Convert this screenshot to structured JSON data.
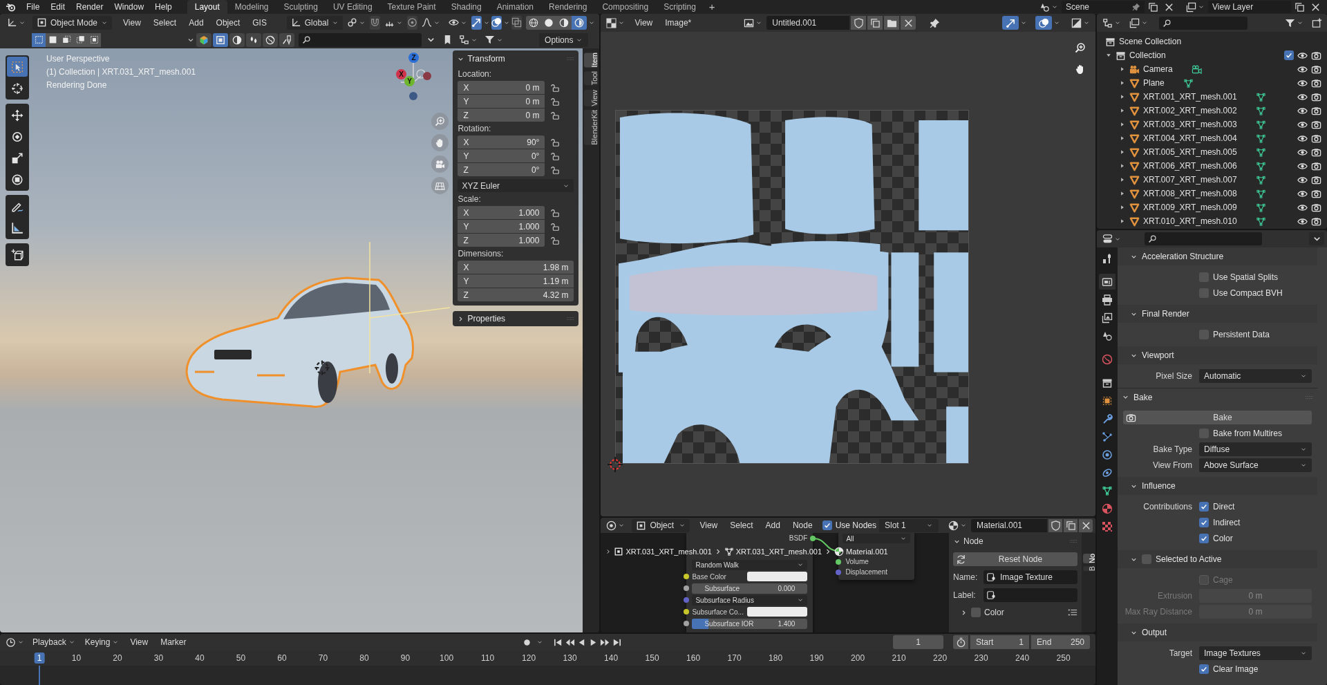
{
  "top_bar": {
    "menus": [
      "File",
      "Edit",
      "Render",
      "Window",
      "Help"
    ],
    "workspaces": [
      {
        "label": "Layout",
        "selected": true
      },
      {
        "label": "Modeling",
        "selected": false
      },
      {
        "label": "Sculpting",
        "selected": false
      },
      {
        "label": "UV Editing",
        "selected": false
      },
      {
        "label": "Texture Paint",
        "selected": false
      },
      {
        "label": "Shading",
        "selected": false
      },
      {
        "label": "Animation",
        "selected": false
      },
      {
        "label": "Rendering",
        "selected": false
      },
      {
        "label": "Compositing",
        "selected": false
      },
      {
        "label": "Scripting",
        "selected": false
      }
    ],
    "add_workspace": "+",
    "scene": "Scene",
    "view_layer": "View Layer"
  },
  "viewport": {
    "mode": "Object Mode",
    "menus": [
      "View",
      "Select",
      "Add",
      "Object",
      "GIS"
    ],
    "orientation": "Global",
    "toggles": [
      {
        "kind": "snap",
        "on": false
      },
      {
        "kind": "proportional",
        "on": false
      },
      {
        "kind": "gizmos",
        "on": true
      },
      {
        "kind": "overlays",
        "on": true
      },
      {
        "kind": "xray",
        "on": false
      }
    ],
    "shading": [
      {
        "kind": "wireframe",
        "selected": false
      },
      {
        "kind": "solid",
        "selected": false
      },
      {
        "kind": "material",
        "selected": false
      },
      {
        "kind": "rendered",
        "selected": true
      }
    ],
    "select_modes": [
      {
        "selected": true
      },
      {
        "selected": false
      },
      {
        "selected": false
      },
      {
        "selected": false
      },
      {
        "selected": false
      }
    ],
    "asset_types": [
      {
        "kind": "model",
        "selected": false
      },
      {
        "kind": "scene",
        "selected": true
      },
      {
        "kind": "material",
        "selected": false
      },
      {
        "kind": "hdr",
        "selected": false
      },
      {
        "kind": "world",
        "selected": false
      },
      {
        "kind": "brush",
        "selected": false
      }
    ],
    "options": "Options",
    "info": [
      "User Perspective",
      "(1) Collection | XRT.031_XRT_mesh.001",
      "Rendering Done"
    ],
    "tool_groups": [
      [
        {
          "kind": "select",
          "selected": true
        },
        {
          "kind": "cursor",
          "selected": false
        }
      ],
      [
        {
          "kind": "move",
          "selected": false
        },
        {
          "kind": "rotate",
          "selected": false
        },
        {
          "kind": "scale",
          "selected": false
        },
        {
          "kind": "transform",
          "selected": false
        }
      ],
      [
        {
          "kind": "annotate",
          "selected": false
        },
        {
          "kind": "measure",
          "selected": false
        }
      ],
      [
        {
          "kind": "add_cube",
          "selected": false
        }
      ]
    ],
    "axes": [
      {
        "label": "Z",
        "color": "#2c6fd6"
      },
      {
        "label": "X",
        "color": "#d1334b"
      },
      {
        "label": "Y",
        "color": "#6cb52c"
      }
    ],
    "sidebar_tabs": [
      {
        "label": "Item",
        "selected": true
      },
      {
        "label": "Tool",
        "selected": false
      },
      {
        "label": "View",
        "selected": false
      },
      {
        "label": "BlenderKit",
        "selected": false
      }
    ],
    "transform": {
      "title": "Transform",
      "expanded": true,
      "groups": [
        {
          "kind": "vector",
          "label": "Location:",
          "locks": true,
          "fields": [
            {
              "axis": "X",
              "value": "0 m"
            },
            {
              "axis": "Y",
              "value": "0 m"
            },
            {
              "axis": "Z",
              "value": "0 m"
            }
          ]
        },
        {
          "kind": "vector",
          "label": "Rotation:",
          "locks": true,
          "fields": [
            {
              "axis": "X",
              "value": "90°"
            },
            {
              "axis": "Y",
              "value": "0°"
            },
            {
              "axis": "Z",
              "value": "0°"
            }
          ]
        },
        {
          "kind": "dropdown",
          "value": "XYZ Euler"
        },
        {
          "kind": "vector",
          "label": "Scale:",
          "locks": true,
          "fields": [
            {
              "axis": "X",
              "value": "1.000"
            },
            {
              "axis": "Y",
              "value": "1.000"
            },
            {
              "axis": "Z",
              "value": "1.000"
            }
          ]
        },
        {
          "kind": "vector",
          "label": "Dimensions:",
          "locks": false,
          "fields": [
            {
              "axis": "X",
              "value": "1.98 m"
            },
            {
              "axis": "Y",
              "value": "1.19 m"
            },
            {
              "axis": "Z",
              "value": "4.32 m"
            }
          ]
        }
      ]
    },
    "properties_panel": {
      "title": "Properties",
      "expanded": false
    }
  },
  "image_editor": {
    "menus": [
      "View",
      "Image*"
    ],
    "image_name": "Untitled.001",
    "toggles": [
      {
        "kind": "gizmos",
        "on": true
      },
      {
        "kind": "overlays",
        "on": true
      }
    ]
  },
  "node_editor": {
    "mode": "Object",
    "menus": [
      "View",
      "Select",
      "Add",
      "Node"
    ],
    "use_nodes": {
      "label": "Use Nodes",
      "checked": true
    },
    "slot": "Slot 1",
    "material": "Material.001",
    "breadcrumbs": [
      {
        "kind": "object",
        "label": "XRT.031_XRT_mesh.001"
      },
      {
        "kind": "mesh",
        "label": "XRT.031_XRT_mesh.001"
      },
      {
        "kind": "material",
        "label": "Material.001"
      }
    ],
    "bsdf_node": {
      "output": "BSDF",
      "rows": [
        {
          "kind": "dropdown",
          "label": "Random Walk"
        },
        {
          "kind": "color",
          "label": "Base Color",
          "color": "#c7c729"
        },
        {
          "kind": "slider",
          "label": "Subsurface",
          "value": "0.000",
          "level": 0,
          "color": "#a1a1a1"
        },
        {
          "kind": "dropdown",
          "label": "Subsurface Radius",
          "color": "#6363c7"
        },
        {
          "kind": "color",
          "label": "Subsurface Co...",
          "color": "#c7c729"
        },
        {
          "kind": "slider",
          "label": "Subsurface IOR",
          "value": "1.400",
          "level": 0.14,
          "color": "#a1a1a1"
        }
      ]
    },
    "output_node": {
      "target": "All",
      "sockets": [
        {
          "label": "Volume",
          "color": "#63c763"
        },
        {
          "label": "Displacement",
          "color": "#6363c7"
        }
      ]
    },
    "sidebar": {
      "tabs": [
        {
          "label": "No",
          "selected": true
        },
        {
          "label": "B",
          "selected": false
        }
      ],
      "panel": "Node",
      "reset": "Reset Node",
      "name_label": "Name:",
      "name": "Image Texture",
      "label_label": "Label:",
      "color_panel": {
        "title": "Color",
        "checked": false,
        "expanded": false
      }
    }
  },
  "timeline": {
    "menus": [
      "Playback",
      "Keying",
      "View",
      "Marker"
    ],
    "frame": "1",
    "start_label": "Start",
    "start": "1",
    "end_label": "End",
    "end": "250",
    "ruler": [
      {
        "label": "1",
        "selected": true
      },
      {
        "label": "10",
        "selected": false
      },
      {
        "label": "20",
        "selected": false
      },
      {
        "label": "30",
        "selected": false
      },
      {
        "label": "40",
        "selected": false
      },
      {
        "label": "50",
        "selected": false
      },
      {
        "label": "60",
        "selected": false
      },
      {
        "label": "70",
        "selected": false
      },
      {
        "label": "80",
        "selected": false
      },
      {
        "label": "90",
        "selected": false
      },
      {
        "label": "100",
        "selected": false
      },
      {
        "label": "110",
        "selected": false
      },
      {
        "label": "120",
        "selected": false
      },
      {
        "label": "130",
        "selected": false
      },
      {
        "label": "140",
        "selected": false
      },
      {
        "label": "150",
        "selected": false
      },
      {
        "label": "160",
        "selected": false
      },
      {
        "label": "170",
        "selected": false
      },
      {
        "label": "180",
        "selected": false
      },
      {
        "label": "190",
        "selected": false
      },
      {
        "label": "200",
        "selected": false
      },
      {
        "label": "210",
        "selected": false
      },
      {
        "label": "220",
        "selected": false
      },
      {
        "label": "230",
        "selected": false
      },
      {
        "label": "240",
        "selected": false
      },
      {
        "label": "250",
        "selected": false
      }
    ]
  },
  "outliner": {
    "items": [
      {
        "label": "Scene Collection",
        "kind": "scene_collection",
        "children": [
          {
            "label": "Collection",
            "kind": "collection",
            "expanded": true,
            "checked": true,
            "children": [
              {
                "label": "Camera",
                "kind": "camera",
                "expanded": false
              },
              {
                "label": "Plane",
                "kind": "mesh",
                "expanded": false
              },
              {
                "label": "XRT.001_XRT_mesh.001",
                "kind": "mesh",
                "expanded": false
              },
              {
                "label": "XRT.002_XRT_mesh.002",
                "kind": "mesh",
                "expanded": false
              },
              {
                "label": "XRT.003_XRT_mesh.003",
                "kind": "mesh",
                "expanded": false
              },
              {
                "label": "XRT.004_XRT_mesh.004",
                "kind": "mesh",
                "expanded": false
              },
              {
                "label": "XRT.005_XRT_mesh.005",
                "kind": "mesh",
                "expanded": false
              },
              {
                "label": "XRT.006_XRT_mesh.006",
                "kind": "mesh",
                "expanded": false
              },
              {
                "label": "XRT.007_XRT_mesh.007",
                "kind": "mesh",
                "expanded": false
              },
              {
                "label": "XRT.008_XRT_mesh.008",
                "kind": "mesh",
                "expanded": false
              },
              {
                "label": "XRT.009_XRT_mesh.009",
                "kind": "mesh",
                "expanded": false
              },
              {
                "label": "XRT.010_XRT_mesh.010",
                "kind": "mesh",
                "expanded": false
              }
            ]
          }
        ]
      }
    ]
  },
  "properties": {
    "tabs": [
      {
        "kind": "tool",
        "selected": false
      },
      {
        "kind": "render",
        "selected": true
      },
      {
        "kind": "output",
        "selected": false
      },
      {
        "kind": "view_layer",
        "selected": false
      },
      {
        "kind": "scene",
        "selected": false
      },
      {
        "kind": "world",
        "selected": false
      },
      {
        "kind": "collection",
        "selected": false
      },
      {
        "kind": "object",
        "selected": false
      },
      {
        "kind": "modifiers",
        "selected": false
      },
      {
        "kind": "particles",
        "selected": false
      },
      {
        "kind": "physics",
        "selected": false
      },
      {
        "kind": "constraints",
        "selected": false
      },
      {
        "kind": "data",
        "selected": false
      },
      {
        "kind": "material",
        "selected": false
      },
      {
        "kind": "texture",
        "selected": false
      }
    ],
    "sections": [
      {
        "kind": "subpanel",
        "title": "Acceleration Structure",
        "expanded": true,
        "rows": [
          {
            "kind": "checkbox",
            "label": "Use Spatial Splits",
            "checked": false
          },
          {
            "kind": "checkbox",
            "label": "Use Compact BVH",
            "checked": false
          }
        ]
      },
      {
        "kind": "subpanel",
        "title": "Final Render",
        "expanded": true,
        "rows": [
          {
            "kind": "checkbox",
            "label": "Persistent Data",
            "checked": false
          }
        ]
      },
      {
        "kind": "subpanel",
        "title": "Viewport",
        "expanded": true,
        "rows": [
          {
            "kind": "dropdown",
            "label": "Pixel Size",
            "value": "Automatic"
          }
        ]
      },
      {
        "kind": "panel",
        "title": "Bake",
        "expanded": true,
        "rows": [
          {
            "kind": "button",
            "label": "Bake"
          },
          {
            "kind": "checkbox",
            "label": "Bake from Multires",
            "checked": false
          },
          {
            "kind": "dropdown",
            "label": "Bake Type",
            "value": "Diffuse"
          },
          {
            "kind": "dropdown",
            "label": "View From",
            "value": "Above Surface"
          }
        ]
      },
      {
        "kind": "subpanel",
        "title": "Influence",
        "expanded": true,
        "rows": [
          {
            "kind": "checkbox",
            "side_label": "Contributions",
            "label": "Direct",
            "checked": true
          },
          {
            "kind": "checkbox",
            "label": "Indirect",
            "checked": true
          },
          {
            "kind": "checkbox",
            "label": "Color",
            "checked": true
          }
        ]
      },
      {
        "kind": "subpanel",
        "title": "Selected to Active",
        "expanded": true,
        "checked": false,
        "rows": [
          {
            "kind": "checkbox",
            "label": "Cage",
            "checked": false,
            "disabled": true
          },
          {
            "kind": "number",
            "label": "Extrusion",
            "value": "0 m",
            "disabled": true
          },
          {
            "kind": "number",
            "label": "Max Ray Distance",
            "value": "0 m",
            "disabled": true
          }
        ]
      },
      {
        "kind": "subpanel",
        "title": "Output",
        "expanded": true,
        "rows": [
          {
            "kind": "dropdown",
            "label": "Target",
            "value": "Image Textures"
          },
          {
            "kind": "checkbox",
            "label": "Clear Image",
            "checked": true
          }
        ]
      }
    ]
  }
}
